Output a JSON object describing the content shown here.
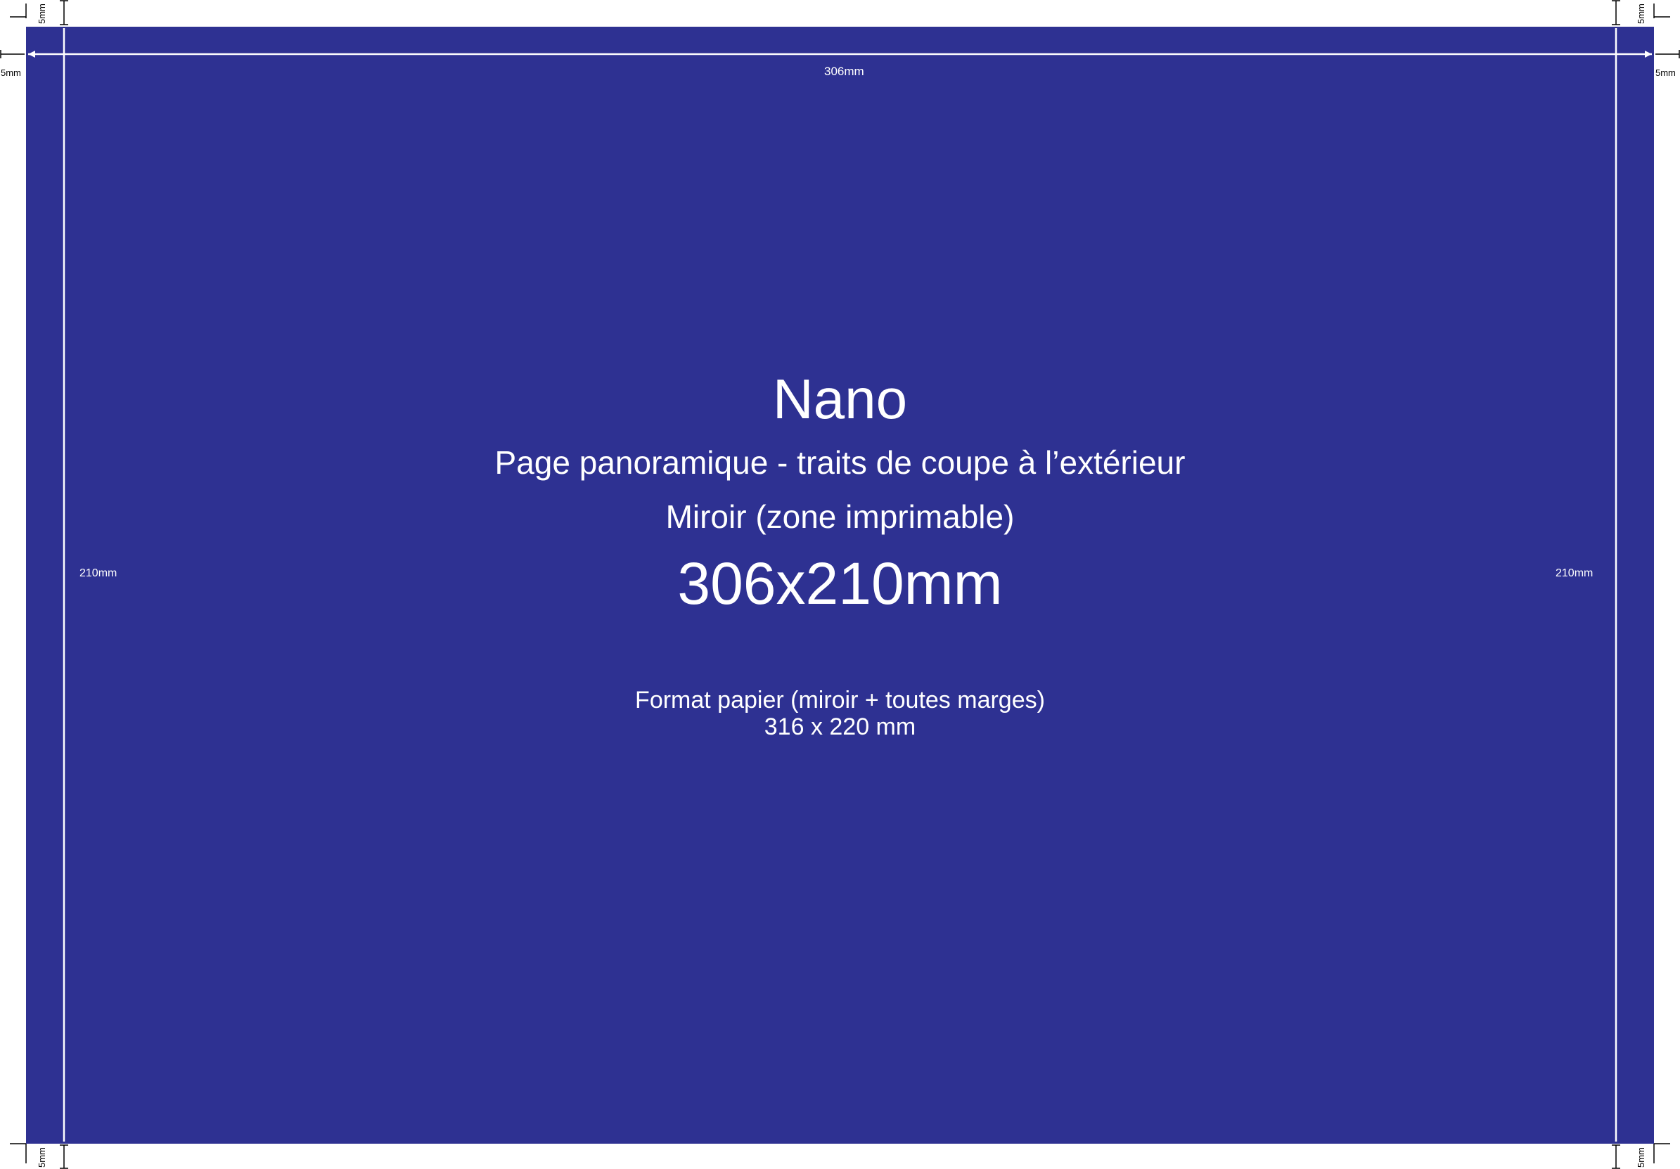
{
  "document": {
    "background_color": "#2e3192",
    "title": "Nano",
    "subtitle": "Page panoramique - traits de coupe à l’extérieur",
    "printable_zone": "Miroir (zone imprimable)",
    "mirror_size": "306x210mm",
    "paper_format_label": "Format papier (miroir + toutes marges)",
    "paper_format_size": "316 x 220 mm"
  },
  "dimensions": {
    "width_label": "306mm",
    "height_label_left": "210mm",
    "height_label_right": "210mm",
    "margin_left": "5mm",
    "margin_right": "5mm",
    "margin_top_left": "5mm",
    "margin_top_right": "5mm",
    "margin_bottom_left": "5mm",
    "margin_bottom_right": "5mm"
  }
}
